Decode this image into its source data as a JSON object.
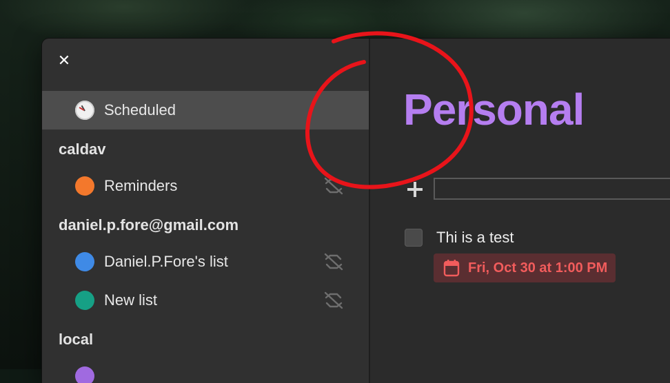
{
  "window": {
    "close_icon": "close-icon"
  },
  "sidebar": {
    "scheduled": {
      "label": "Scheduled",
      "icon": "clock-icon"
    },
    "sections": [
      {
        "header": "caldav",
        "items": [
          {
            "label": "Reminders",
            "color": "#f3782c",
            "sync_icon": "sync-disabled-icon"
          }
        ]
      },
      {
        "header": "daniel.p.fore@gmail.com",
        "items": [
          {
            "label": "Daniel.P.Fore's list",
            "color": "#3f8ae6",
            "sync_icon": "sync-disabled-icon"
          },
          {
            "label": "New list",
            "color": "#16a085",
            "sync_icon": "sync-disabled-icon"
          }
        ]
      },
      {
        "header": "local",
        "items": [
          {
            "label": "",
            "color": "#a06ae0"
          }
        ]
      }
    ]
  },
  "main": {
    "title": "Personal",
    "title_color": "#b57ef0",
    "new_task": {
      "value": "",
      "placeholder": "",
      "add_icon": "plus-icon"
    },
    "tasks": [
      {
        "title": "Thi is a test",
        "completed": false,
        "due": "Fri, Oct 30 at 1:00 PM",
        "due_icon": "calendar-icon",
        "due_color": "#f25c5c"
      }
    ]
  },
  "annotation": {
    "color": "#e8141a",
    "shape": "circle"
  }
}
